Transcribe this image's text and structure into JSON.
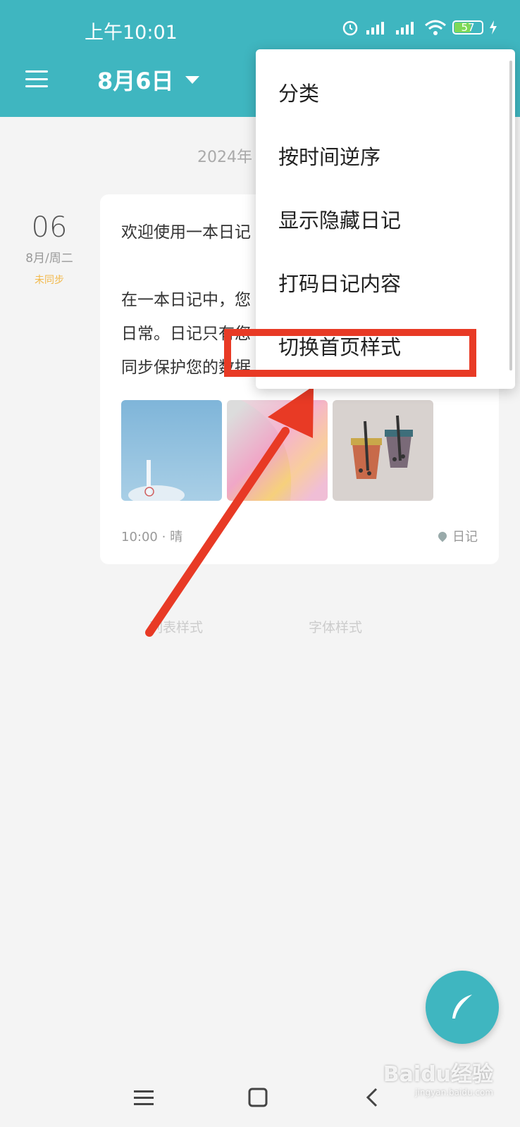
{
  "status_bar": {
    "time": "上午10:01",
    "battery": "57"
  },
  "header": {
    "title": "8月6日"
  },
  "timeline": {
    "year_label": "2024年"
  },
  "entry": {
    "day": "06",
    "month_week": "8月/周二",
    "sync_status": "未同步",
    "title": "欢迎使用一本日记",
    "body_line1": "在一本日记中，您",
    "body_line2": "日常。日记只有您",
    "body_line3": "同步保护您的数据",
    "time": "10:00",
    "weather": "晴",
    "category": "日记",
    "images": [
      "sky-photo",
      "abstract-gradient",
      "bubble-tea-drawing"
    ]
  },
  "style_links": {
    "list": "列表样式",
    "font": "字体样式"
  },
  "dropdown": {
    "items": [
      "分类",
      "按时间逆序",
      "显示隐藏日记",
      "打码日记内容",
      "切换首页样式"
    ]
  },
  "annotation": {
    "highlight_color": "#e83a25",
    "highlighted_item": "切换首页样式"
  },
  "colors": {
    "accent": "#3fb6c0",
    "sync_warning": "#f2b84a"
  },
  "watermark": {
    "brand": "Baidu经验",
    "url": "jingyan.baidu.com"
  }
}
